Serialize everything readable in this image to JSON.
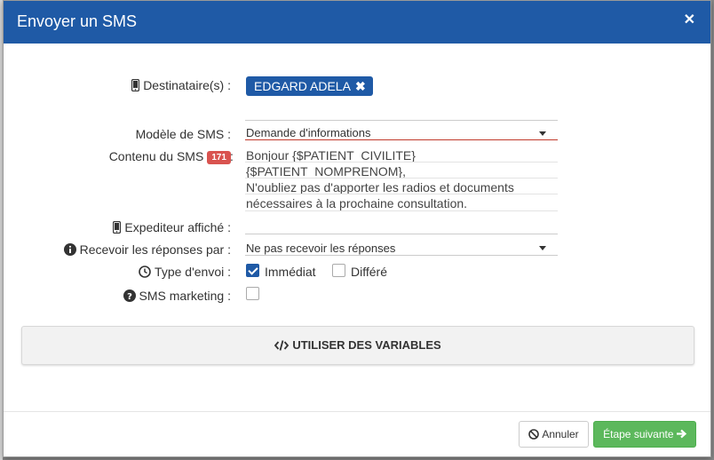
{
  "header": {
    "title": "Envoyer un SMS",
    "close_icon": "close-icon"
  },
  "form": {
    "recipients": {
      "label": "Destinataire(s) :",
      "icon": "mobile-phone-icon",
      "tag": "EDGARD ADELA"
    },
    "template": {
      "label": "Modèle de SMS :",
      "value": "Demande d'informations",
      "accent": "#c0392b"
    },
    "content": {
      "label": "Contenu du SMS",
      "count": "171",
      "count_color": "#d9534f",
      "colon": ":",
      "lines": [
        "Bonjour {$PATIENT_CIVILITE}",
        "{$PATIENT_NOMPRENOM},",
        "N'oubliez pas d'apporter les radios et documents",
        "nécessaires à la prochaine consultation."
      ]
    },
    "sender": {
      "label": "Expediteur affiché :",
      "icon": "mobile-phone-icon",
      "value": ""
    },
    "replies": {
      "label": "Recevoir les réponses par :",
      "icon": "info-circle-icon",
      "value": "Ne pas recevoir les réponses"
    },
    "send_type": {
      "label": "Type d'envoi :",
      "icon": "clock-icon",
      "options": [
        {
          "label": "Immédiat",
          "checked": true
        },
        {
          "label": "Différé",
          "checked": false
        }
      ]
    },
    "marketing": {
      "label": "SMS marketing :",
      "icon": "question-circle-icon",
      "checked": false
    }
  },
  "variables_button": {
    "label": "UTILISER DES VARIABLES",
    "icon": "code-icon"
  },
  "footer": {
    "cancel_label": "Annuler",
    "cancel_icon": "ban-icon",
    "next_label": "Étape suivante",
    "next_icon": "arrow-right-icon"
  },
  "colors": {
    "header": "#1f5aa6",
    "primary": "#1f5aa6",
    "success": "#5cb85c"
  }
}
